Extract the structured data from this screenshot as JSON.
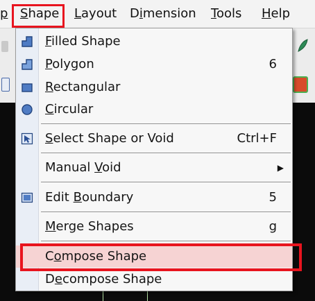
{
  "menubar": {
    "items": [
      {
        "lead": "",
        "mnemonic": "p",
        "rest": ""
      },
      {
        "lead": "",
        "mnemonic": "S",
        "rest": "hape"
      },
      {
        "lead": "",
        "mnemonic": "L",
        "rest": "ayout"
      },
      {
        "lead": "D",
        "mnemonic": "i",
        "rest": "mension"
      },
      {
        "lead": "",
        "mnemonic": "T",
        "rest": "ools"
      },
      {
        "lead": "",
        "mnemonic": "H",
        "rest": "elp"
      }
    ]
  },
  "shape_menu": {
    "items": [
      {
        "lead": "",
        "mnemonic": "F",
        "rest": "illed Shape",
        "shortcut": "",
        "icon": "filled-shape-icon"
      },
      {
        "lead": "",
        "mnemonic": "P",
        "rest": "olygon",
        "shortcut": "6",
        "icon": "polygon-icon"
      },
      {
        "lead": "",
        "mnemonic": "R",
        "rest": "ectangular",
        "shortcut": "",
        "icon": "rectangle-icon"
      },
      {
        "lead": "",
        "mnemonic": "C",
        "rest": "ircular",
        "shortcut": "",
        "icon": "circle-icon"
      },
      {
        "lead": "",
        "mnemonic": "S",
        "rest": "elect Shape or Void",
        "shortcut": "Ctrl+F",
        "icon": "select-shape-icon"
      },
      {
        "lead": "Manual ",
        "mnemonic": "V",
        "rest": "oid",
        "shortcut": "",
        "icon": ""
      },
      {
        "lead": "Edit ",
        "mnemonic": "B",
        "rest": "oundary",
        "shortcut": "5",
        "icon": "edit-boundary-icon"
      },
      {
        "lead": "",
        "mnemonic": "M",
        "rest": "erge Shapes",
        "shortcut": "g",
        "icon": ""
      },
      {
        "lead": "C",
        "mnemonic": "o",
        "rest": "mpose Shape",
        "shortcut": "",
        "icon": ""
      },
      {
        "lead": "D",
        "mnemonic": "e",
        "rest": "compose Shape",
        "shortcut": "",
        "icon": ""
      }
    ]
  },
  "colors": {
    "annotation_red": "#e8141e",
    "menu_background": "#f7f7f7",
    "highlighted_item": "#f6d3d3",
    "canvas_background": "#0b0b0b"
  }
}
